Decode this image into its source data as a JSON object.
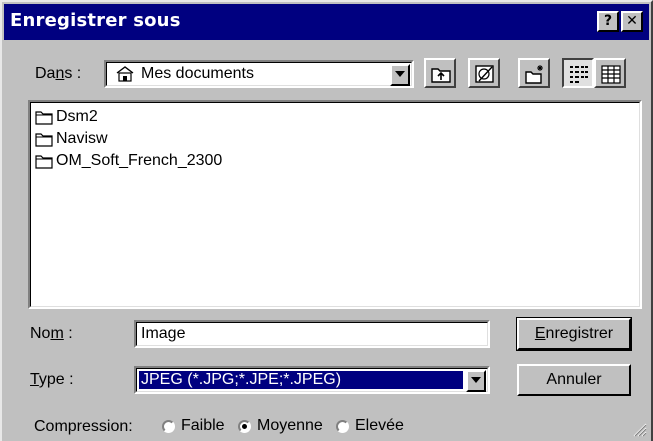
{
  "dialog": {
    "title": "Enregistrer sous",
    "help_glyph": "?",
    "close_glyph": "✕"
  },
  "lookin": {
    "label_prefix": "Da",
    "label_underline": "n",
    "label_suffix": "s :",
    "value": "Mes documents"
  },
  "files": [
    {
      "name": "Dsm2",
      "icon": "folder-icon"
    },
    {
      "name": "Navisw",
      "icon": "folder-icon"
    },
    {
      "name": "OM_Soft_French_2300",
      "icon": "folder-icon"
    }
  ],
  "filename": {
    "label_prefix": "No",
    "label_underline": "m",
    "label_suffix": " :",
    "value": "Image"
  },
  "filetype": {
    "label_underline": "T",
    "label_suffix": "ype :",
    "value": "JPEG (*.JPG;*.JPE;*.JPEG)"
  },
  "buttons": {
    "save_underline": "E",
    "save_rest": "nregistrer",
    "cancel": "Annuler"
  },
  "compression": {
    "label": "Compression:",
    "options": [
      "Faible",
      "Moyenne",
      "Elevée"
    ],
    "selected": "Moyenne"
  },
  "colors": {
    "titlebar": "#000080",
    "face": "#c0c0c0",
    "selection": "#000080"
  }
}
